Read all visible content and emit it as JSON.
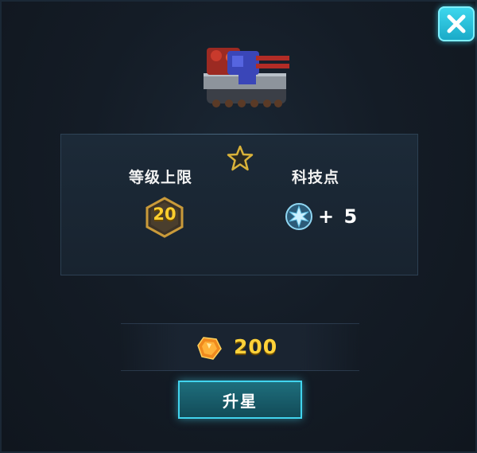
{
  "dialog": {
    "close_icon": "close-icon",
    "unit_icon": "tank-icon",
    "star_icon": "star-icon"
  },
  "stats": {
    "level_cap_label": "等级上限",
    "level_cap_value": "20",
    "tech_points_label": "科技点",
    "tech_points_value": "+ 5",
    "tech_icon": "snowflake-crystal-icon"
  },
  "cost": {
    "icon": "gem-icon",
    "amount": "200"
  },
  "actions": {
    "upgrade_label": "升星"
  },
  "colors": {
    "accent_cyan": "#41d4ee",
    "gold": "#ffd23a"
  }
}
